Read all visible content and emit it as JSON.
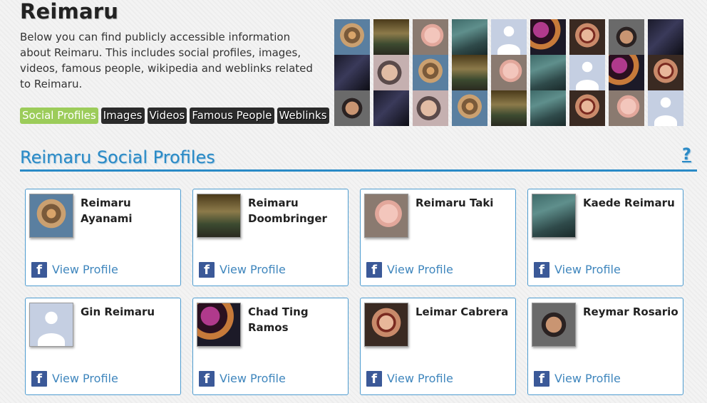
{
  "page": {
    "title": "Reimaru",
    "intro": "Below you can find publicly accessible information about Reimaru. This includes social profiles, images, videos, famous people, wikipedia and weblinks related to Reimaru."
  },
  "nav": [
    {
      "label": "Social Profiles",
      "active": true
    },
    {
      "label": "Images",
      "active": false
    },
    {
      "label": "Videos",
      "active": false
    },
    {
      "label": "Famous People",
      "active": false
    },
    {
      "label": "Weblinks",
      "active": false
    }
  ],
  "section": {
    "title": "Reimaru Social Profiles",
    "help_glyph": "?"
  },
  "profiles": [
    {
      "name": "Reimaru Ayanami",
      "network": "facebook",
      "icon": "f",
      "link_label": "View Profile",
      "avatar": "figure"
    },
    {
      "name": "Reimaru Doombringer",
      "network": "facebook",
      "icon": "f",
      "link_label": "View Profile",
      "avatar": "statue"
    },
    {
      "name": "Reimaru Taki",
      "network": "facebook",
      "icon": "f",
      "link_label": "View Profile",
      "avatar": "pig"
    },
    {
      "name": "Kaede Reimaru",
      "network": "facebook",
      "icon": "f",
      "link_label": "View Profile",
      "avatar": "anime"
    },
    {
      "name": "Gin Reimaru",
      "network": "facebook",
      "icon": "f",
      "link_label": "View Profile",
      "avatar": "silhouette"
    },
    {
      "name": "Chad Ting Ramos",
      "network": "facebook",
      "icon": "f",
      "link_label": "View Profile",
      "avatar": "guy-lights"
    },
    {
      "name": "Leimar Cabrera",
      "network": "facebook",
      "icon": "f",
      "link_label": "View Profile",
      "avatar": "glasses"
    },
    {
      "name": "Reymar Rosario",
      "network": "facebook",
      "icon": "f",
      "link_label": "View Profile",
      "avatar": "reymar"
    }
  ],
  "colors": {
    "accent": "#2a8ac6",
    "active_tab": "#9ccc5a",
    "tab_bg": "#2b2b2b",
    "facebook": "#3b5998",
    "link": "#3f86bd"
  }
}
